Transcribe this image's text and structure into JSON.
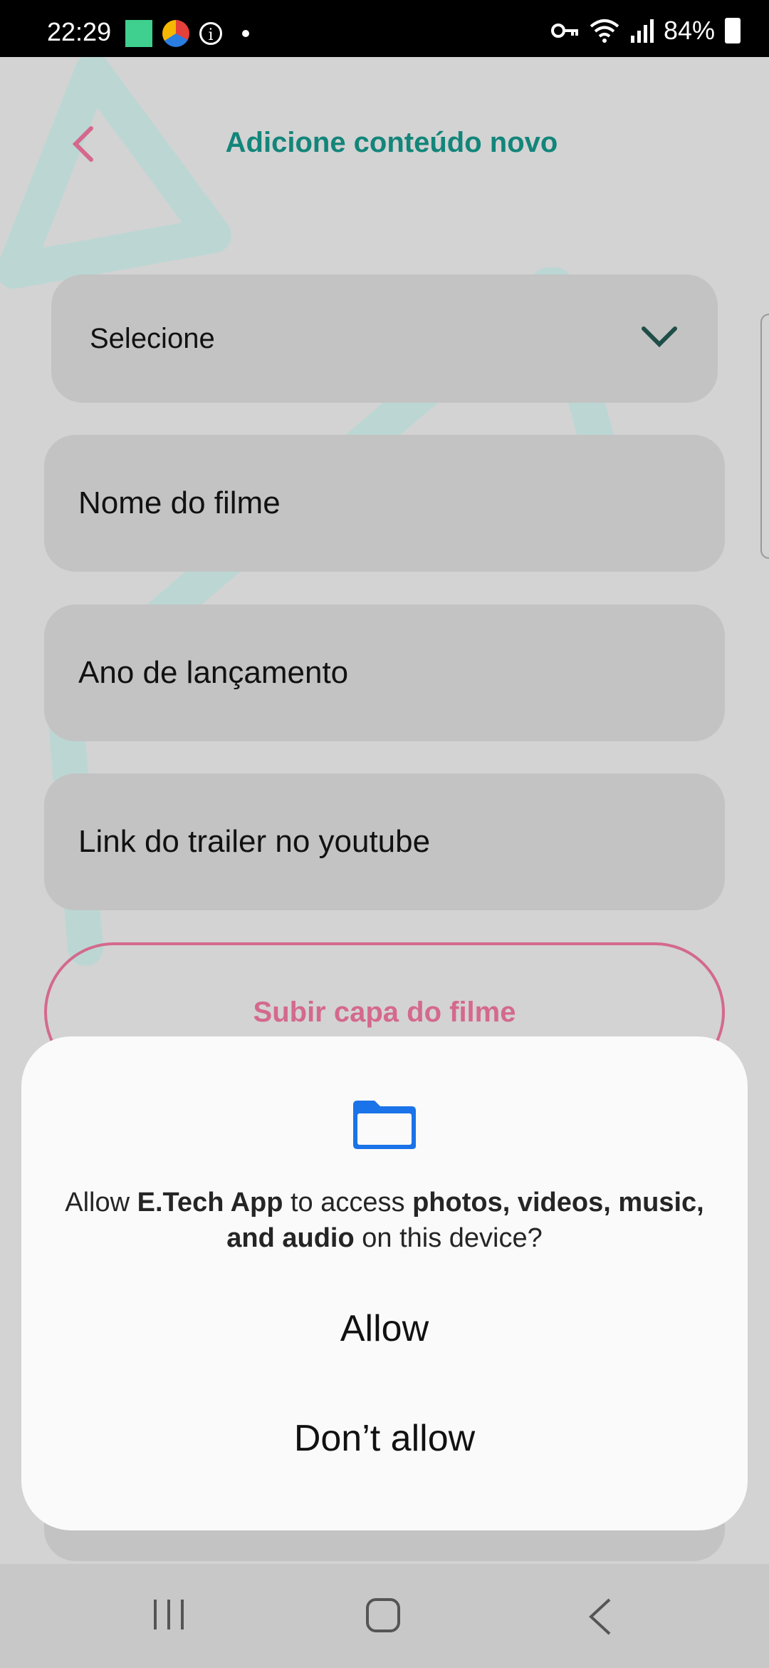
{
  "status_bar": {
    "time": "22:29",
    "battery": "84%",
    "icons": [
      "app-square-icon",
      "color-wheel-icon",
      "info-icon",
      "dot-icon",
      "vpn-key-icon",
      "wifi-icon",
      "signal-icon",
      "battery-icon"
    ]
  },
  "header": {
    "title": "Adicione conteúdo novo",
    "back_icon": "chevron-left-icon"
  },
  "form": {
    "select_placeholder": "Selecione",
    "movie_name_placeholder": "Nome do filme",
    "release_year_placeholder": "Ano de lançamento",
    "trailer_link_placeholder": "Link do trailer no youtube",
    "upload_cover_label": "Subir capa do filme"
  },
  "dialog": {
    "message_prefix": "Allow ",
    "app_name": "E.Tech App",
    "message_middle": " to access ",
    "media_types": "photos, videos, music, and audio",
    "message_suffix": " on this device?",
    "allow_label": "Allow",
    "deny_label": "Don’t allow",
    "icon": "folder-icon"
  },
  "navigation": {
    "icons": [
      "recents-icon",
      "home-icon",
      "back-icon"
    ]
  },
  "colors": {
    "accent": "#13857a",
    "pink": "#d4698d",
    "background": "#d3d3d3",
    "field": "#c3c3c3",
    "folder_blue": "#1a73e8"
  }
}
